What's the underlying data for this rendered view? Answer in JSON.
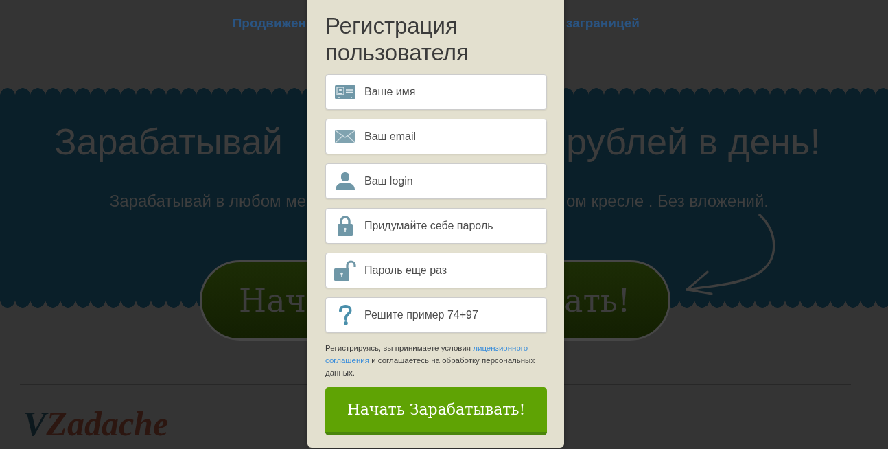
{
  "background_page": {
    "nav_left": "Продвижен",
    "nav_right": "заграницей",
    "headline_left": "Зарабатывай",
    "headline_right": "рублей в день!",
    "subtitle_left": "Зарабатывай в любом ме",
    "subtitle_right": "ом кресле . Без вложений.",
    "cta_left": "Нач",
    "cta_right": "ать!",
    "logo": {
      "first": "V",
      "rest": "Zadache"
    }
  },
  "dialog": {
    "title": "Регистрация пользователя",
    "fields": [
      {
        "kind": "name",
        "placeholder": "Ваше имя"
      },
      {
        "kind": "email",
        "placeholder": "Ваш email"
      },
      {
        "kind": "login",
        "placeholder": "Ваш login"
      },
      {
        "kind": "password",
        "placeholder": "Придумайте себе пароль"
      },
      {
        "kind": "password_repeat",
        "placeholder": "Пароль еще раз"
      },
      {
        "kind": "captcha",
        "placeholder": "Решите пример 74+97"
      }
    ],
    "consent": {
      "text_before": "Регистрируясь, вы принимаете условия",
      "link_parts": [
        "лицензионного",
        "соглашения"
      ],
      "text_after": "и соглашаетесь на обработку персональных данных."
    },
    "submit": "Начать Зарабатывать!"
  }
}
